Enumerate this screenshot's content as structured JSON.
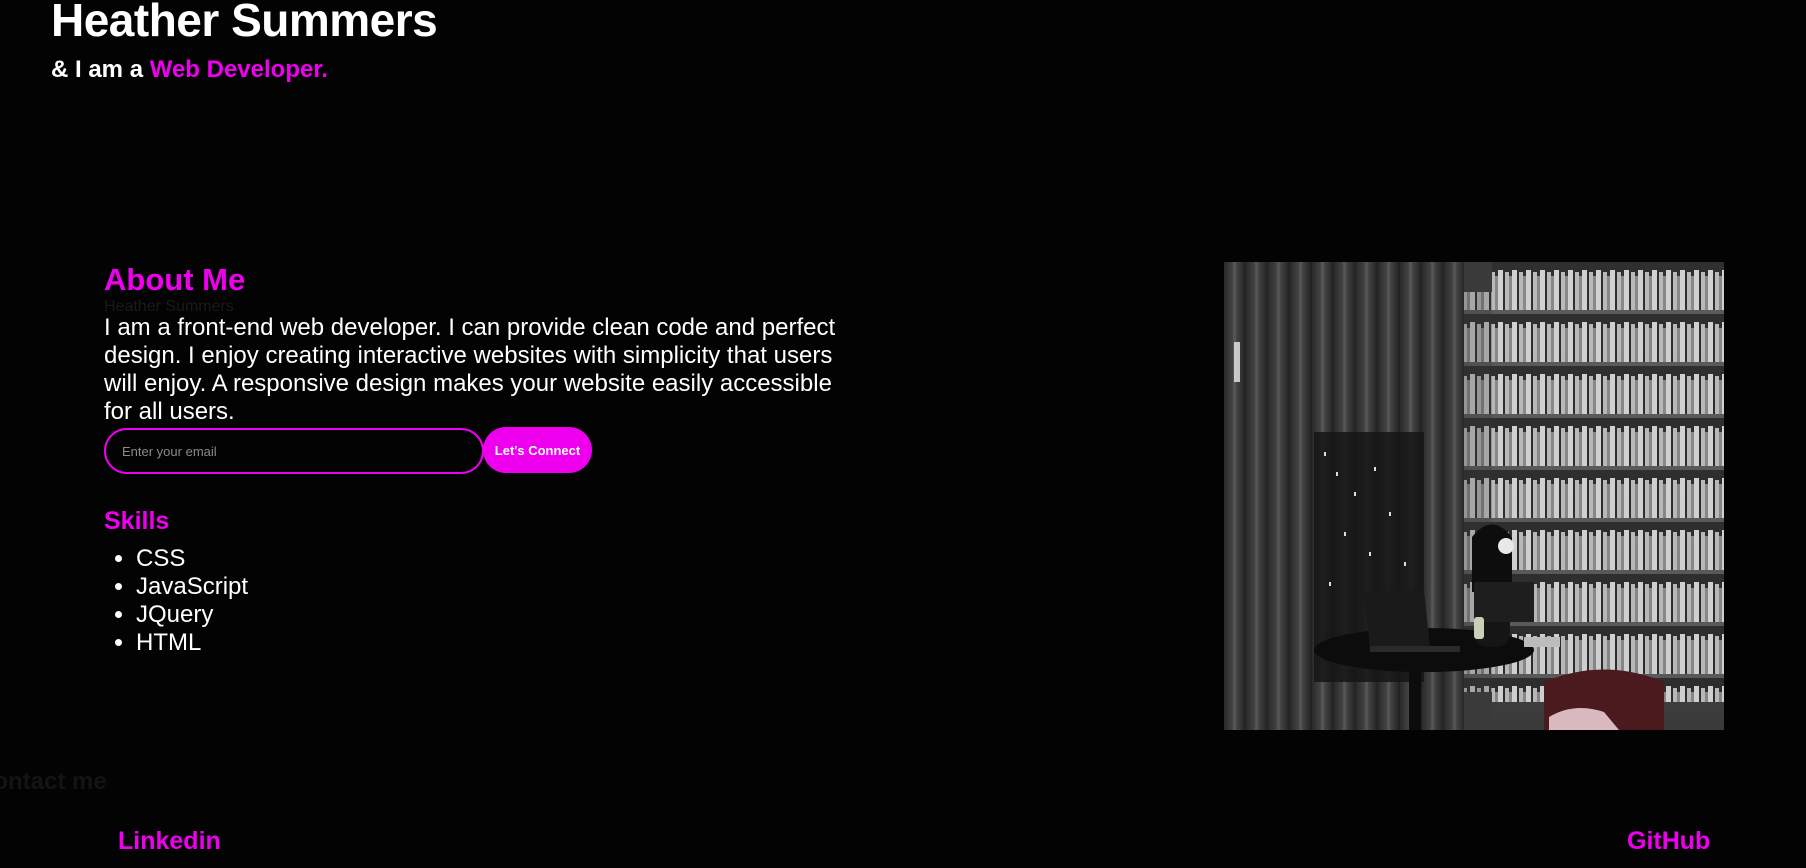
{
  "hero": {
    "name": "Heather Summers",
    "tag_prefix": "& I am a ",
    "role": "Web Developer."
  },
  "about": {
    "heading": "About Me",
    "ghost_text": "Heather Summers",
    "text": "I am a front-end web developer. I can provide clean code and perfect design. I enjoy creating interactive websites with simplicity that users will enjoy. A responsive design makes your website easily accessible for all users."
  },
  "signup": {
    "placeholder": "Enter your email",
    "button_label": "Let's Connect"
  },
  "skills": {
    "heading": "Skills",
    "items": [
      "CSS",
      "JavaScript",
      "JQuery",
      "HTML"
    ]
  },
  "contact": {
    "ghost_text": "Contact me"
  },
  "footer": {
    "linkedin_label": "Linkedin",
    "github_label": "GitHub"
  },
  "colors": {
    "accent": "#ee00ee",
    "background": "#040304",
    "text": "#ffffff"
  },
  "icons": {
    "photo": "developer-library-photo"
  }
}
